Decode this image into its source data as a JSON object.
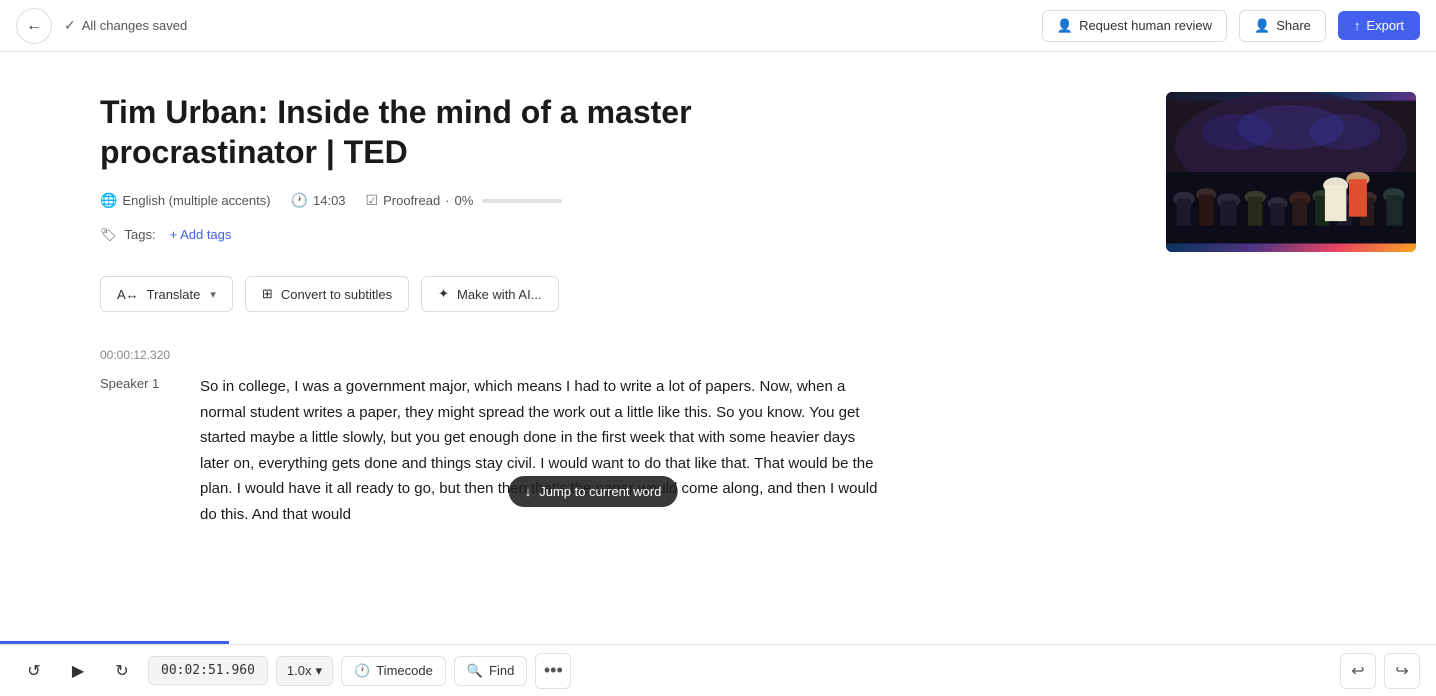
{
  "header": {
    "back_label": "←",
    "saved_status": "All changes saved",
    "request_review_label": "Request human review",
    "share_label": "Share",
    "export_label": "Export"
  },
  "document": {
    "title": "Tim Urban: Inside the mind of a master procrastinator | TED",
    "language": "English (multiple accents)",
    "duration": "14:03",
    "proofread_label": "Proofread",
    "proofread_percent": "0%",
    "tags_label": "Tags:",
    "add_tags_label": "+ Add tags"
  },
  "actions": {
    "translate_label": "Translate",
    "convert_label": "Convert to subtitles",
    "make_ai_label": "Make with AI..."
  },
  "transcript": {
    "timestamp": "00:00:12.320",
    "speaker": "Speaker 1",
    "text": "So in college, I was a government major, which means I had to write a lot of papers. Now, when a normal student writes a paper, they might spread the work out a little like this. So you know. You get started maybe a little slowly, but you get enough done in the first week that with some heavier days later on, everything gets done and things stay civil. I would want to do that like that. That would be the plan. I would have it all ready to go, but then then that's the paper would come along, and then I would do this. And that would"
  },
  "tooltip": {
    "jump_label": "Jump to current word",
    "arrow": "↓"
  },
  "player": {
    "rewind_icon": "↺",
    "play_icon": "▶",
    "forward_icon": "↻",
    "current_time": "00:02:51.960",
    "speed": "1.0x",
    "timecode_label": "Timecode",
    "find_label": "Find",
    "more_icon": "•••",
    "undo_icon": "↩",
    "redo_icon": "↪"
  }
}
